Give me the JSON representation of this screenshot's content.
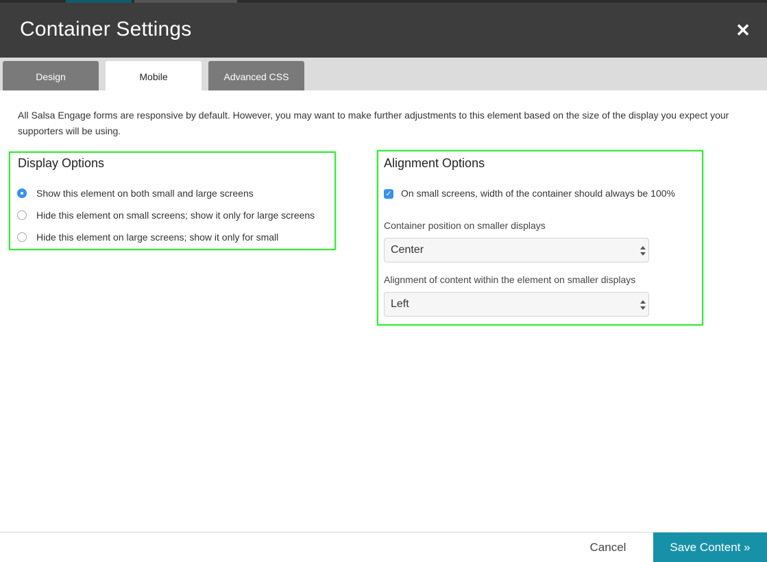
{
  "dialog": {
    "title": "Container Settings",
    "close_icon": "close-icon"
  },
  "tabs": [
    {
      "label": "Design",
      "active": false
    },
    {
      "label": "Mobile",
      "active": true
    },
    {
      "label": "Advanced CSS",
      "active": false
    }
  ],
  "intro_text": "All Salsa Engage forms are responsive by default. However, you may want to make further adjustments to this element based on the size of the display you expect your supporters will be using.",
  "display_options": {
    "title": "Display Options",
    "options": [
      {
        "label": "Show this element on both small and large screens",
        "selected": true
      },
      {
        "label": "Hide this element on small screens; show it only for large screens",
        "selected": false
      },
      {
        "label": "Hide this element on large screens; show it only for small",
        "selected": false
      }
    ]
  },
  "alignment_options": {
    "title": "Alignment Options",
    "full_width_checkbox": {
      "label": "On small screens, width of the container should always be 100%",
      "checked": true
    },
    "position": {
      "label": "Container position on smaller displays",
      "value": "Center"
    },
    "content_alignment": {
      "label": "Alignment of content within the element on smaller displays",
      "value": "Left"
    }
  },
  "footer": {
    "cancel_label": "Cancel",
    "save_label": "Save Content »"
  },
  "colors": {
    "header_bg": "#3d3d3d",
    "accent": "#1791a8",
    "highlight_box": "#38e838",
    "tab_inactive": "#7a7a7a"
  }
}
